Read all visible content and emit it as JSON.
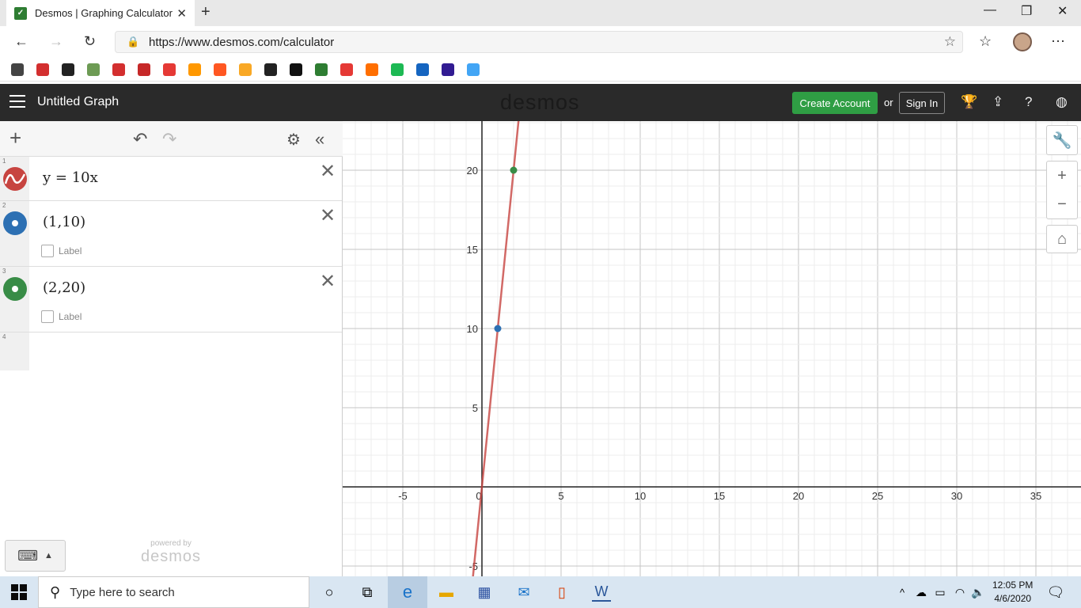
{
  "browser": {
    "tab_title": "Desmos | Graphing Calculator",
    "url": "https://www.desmos.com/calculator"
  },
  "bookmarks": [
    {
      "icon": "bookmark-1-icon",
      "color": "#444"
    },
    {
      "icon": "bookmark-2-icon",
      "color": "#d32f2f"
    },
    {
      "icon": "bookmark-3-icon",
      "color": "#222"
    },
    {
      "icon": "bookmark-4-icon",
      "color": "#6d9b54"
    },
    {
      "icon": "bookmark-5-icon",
      "color": "#d32f2f"
    },
    {
      "icon": "bookmark-6-icon",
      "color": "#c62828"
    },
    {
      "icon": "bookmark-7-icon",
      "color": "#e53935"
    },
    {
      "icon": "bookmark-8-icon",
      "color": "#ff9800"
    },
    {
      "icon": "bookmark-9-icon",
      "color": "#ff5722"
    },
    {
      "icon": "bookmark-10-icon",
      "color": "#f9a825"
    },
    {
      "icon": "bookmark-11-icon",
      "color": "#222"
    },
    {
      "icon": "bookmark-12-icon",
      "color": "#111"
    },
    {
      "icon": "bookmark-13-icon",
      "color": "#2e7d32"
    },
    {
      "icon": "bookmark-14-icon",
      "color": "#e53935"
    },
    {
      "icon": "bookmark-15-icon",
      "color": "#ff6f00"
    },
    {
      "icon": "bookmark-16-icon",
      "color": "#1db954"
    },
    {
      "icon": "bookmark-17-icon",
      "color": "#1565c0"
    },
    {
      "icon": "bookmark-18-icon",
      "color": "#311b92"
    },
    {
      "icon": "bookmark-19-icon",
      "color": "#42a5f5"
    }
  ],
  "desmos": {
    "graph_title": "Untitled Graph",
    "logo": "desmos",
    "create_account": "Create Account",
    "or": "or",
    "sign_in": "Sign In",
    "powered_by": "powered by",
    "powered_logo": "desmos"
  },
  "expressions": [
    {
      "num": "1",
      "latex": "y = 10x",
      "color": "#c74440"
    },
    {
      "num": "2",
      "latex": "(1,10)",
      "color": "#2d70b3",
      "label": "Label"
    },
    {
      "num": "3",
      "latex": "(2,20)",
      "color": "#388c46",
      "label": "Label"
    },
    {
      "num": "4"
    }
  ],
  "graph": {
    "x_ticks": [
      "-5",
      "0",
      "5",
      "10",
      "15",
      "20",
      "25",
      "30",
      "35"
    ],
    "y_ticks": [
      "-5",
      "5",
      "10",
      "15",
      "20"
    ],
    "line_slope": 10,
    "points": [
      {
        "x": 1,
        "y": 10,
        "color": "#2d70b3"
      },
      {
        "x": 2,
        "y": 20,
        "color": "#388c46"
      }
    ],
    "line_color": "#c74440"
  },
  "taskbar": {
    "search_placeholder": "Type here to search",
    "time": "12:05 PM",
    "date": "4/6/2020"
  }
}
